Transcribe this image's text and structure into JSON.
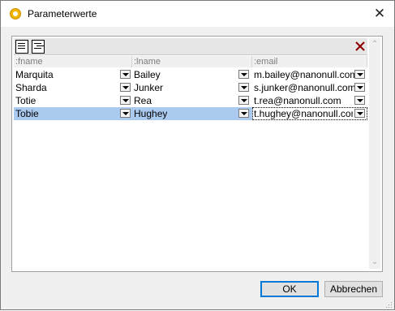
{
  "window": {
    "title": "Parameterwerte",
    "close_glyph": "✕"
  },
  "columns": [
    ":fname",
    ":lname",
    ":email"
  ],
  "rows": [
    {
      "fname": "Marquita",
      "lname": "Bailey",
      "email": "m.bailey@nanonull.com"
    },
    {
      "fname": "Sharda",
      "lname": "Junker",
      "email": "s.junker@nanonull.com"
    },
    {
      "fname": "Totie",
      "lname": "Rea",
      "email": "t.rea@nanonull.com"
    },
    {
      "fname": "Tobie",
      "lname": "Hughey",
      "email": "t.hughey@nanonull.com"
    }
  ],
  "selected_row": 4,
  "buttons": {
    "ok": "OK",
    "cancel": "Abbrechen"
  },
  "colors": {
    "selection": "#aacbef",
    "app_icon": "#f2b600",
    "delete_icon": "#8b0000"
  },
  "icons": [
    "app-icon",
    "add-row-icon",
    "insert-row-icon",
    "delete-icon",
    "close-icon",
    "scroll-up-icon",
    "scroll-down-icon",
    "dropdown-arrow-icon",
    "resize-grip-icon"
  ]
}
